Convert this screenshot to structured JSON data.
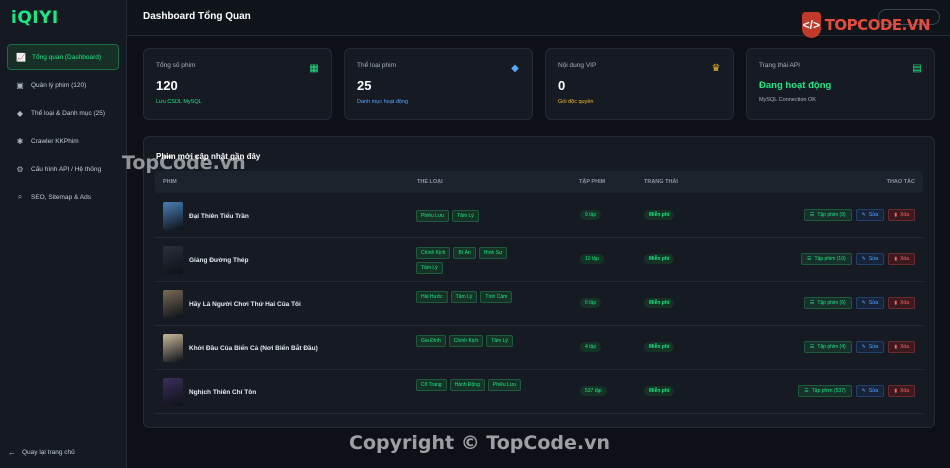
{
  "app": {
    "logo": "iQIYI"
  },
  "sidebar": {
    "items": [
      {
        "label": "Tổng quan (Dashboard)",
        "icon": "chart-line-icon",
        "glyph": "📈",
        "active": true
      },
      {
        "label": "Quản lý phim (120)",
        "icon": "film-icon",
        "glyph": "▣",
        "active": false
      },
      {
        "label": "Thể loại & Danh mục (25)",
        "icon": "tag-icon",
        "glyph": "◆",
        "active": false
      },
      {
        "label": "Crawler KKPhim",
        "icon": "spider-icon",
        "glyph": "✱",
        "active": false
      },
      {
        "label": "Cấu hình API / Hệ thống",
        "icon": "gear-icon",
        "glyph": "⚙",
        "active": false
      },
      {
        "label": "SEO, Sitemap & Ads",
        "icon": "search-icon",
        "glyph": "⌕",
        "active": false
      }
    ],
    "back_label": "Quay lại trang chủ"
  },
  "header": {
    "title": "Dashboard Tổng Quan"
  },
  "stats": [
    {
      "label": "Tổng số phim",
      "value": "120",
      "sub": "Lưu CSDL MySQL",
      "sub_color": "#1ce783",
      "icon": "film-icon",
      "icon_color": "#1ce783"
    },
    {
      "label": "Thể loại phim",
      "value": "25",
      "sub": "Danh mục hoạt động",
      "sub_color": "#58a6ff",
      "icon": "tags-icon",
      "icon_color": "#58a6ff"
    },
    {
      "label": "Nội dung VIP",
      "value": "0",
      "sub": "Gói độc quyền",
      "sub_color": "#f5b72b",
      "icon": "crown-icon",
      "icon_color": "#f5b72b"
    },
    {
      "label": "Trạng thái API",
      "value": "Đang hoạt động",
      "sub": "MySQL Connection OK",
      "sub_color": "#aab3bf",
      "icon": "server-icon",
      "icon_color": "#1ce783"
    }
  ],
  "table": {
    "title": "Phim mới cập nhật gần đây",
    "headers": {
      "movie": "PHIM",
      "genre": "THỂ LOẠI",
      "episodes": "TẬP PHIM",
      "status": "TRẠNG THÁI",
      "actions": "THAO TÁC"
    },
    "rows": [
      {
        "title": "Đại Thiên Tiểu Trần",
        "tags": [
          "Phiêu Lưu",
          "Tâm Lý"
        ],
        "episodes": "9 tập",
        "status": "Miễn phí",
        "ep_btn": "Tập phim (9)",
        "edit": "Sửa",
        "delete": "Xóa",
        "poster": "#4a7fb5"
      },
      {
        "title": "Giảng Đường Thép",
        "tags": [
          "Chính Kịch",
          "Bí Ẩn",
          "Hình Sự",
          "Tâm Lý"
        ],
        "episodes": "10 tập",
        "status": "Miễn phí",
        "ep_btn": "Tập phim (10)",
        "edit": "Sửa",
        "delete": "Xóa",
        "poster": "#2c2f3a"
      },
      {
        "title": "Hãy Là Người Chơi Thứ Hai Của Tôi",
        "tags": [
          "Hài Hước",
          "Tâm Lý",
          "Tình Cảm"
        ],
        "episodes": "6 tập",
        "status": "Miễn phí",
        "ep_btn": "Tập phim (6)",
        "edit": "Sửa",
        "delete": "Xóa",
        "poster": "#7a6a55"
      },
      {
        "title": "Khởi Đầu Của Biển Cả (Nơi Biển Bắt Đầu)",
        "tags": [
          "Gia Đình",
          "Chính Kịch",
          "Tâm Lý"
        ],
        "episodes": "4 tập",
        "status": "Miễn phí",
        "ep_btn": "Tập phim (4)",
        "edit": "Sửa",
        "delete": "Xóa",
        "poster": "#c9b89a"
      },
      {
        "title": "Nghịch Thiên Chí Tôn",
        "tags": [
          "Cổ Trang",
          "Hành Động",
          "Phiêu Lưu"
        ],
        "episodes": "537 tập",
        "status": "Miễn phí",
        "ep_btn": "Tập phim (537)",
        "edit": "Sửa",
        "delete": "Xóa",
        "poster": "#3b2e5a"
      }
    ]
  },
  "watermarks": {
    "center": "TopCode.vn",
    "bottom": "Copyright © TopCode.vn",
    "logo_text": "TOPCODE.VN"
  }
}
